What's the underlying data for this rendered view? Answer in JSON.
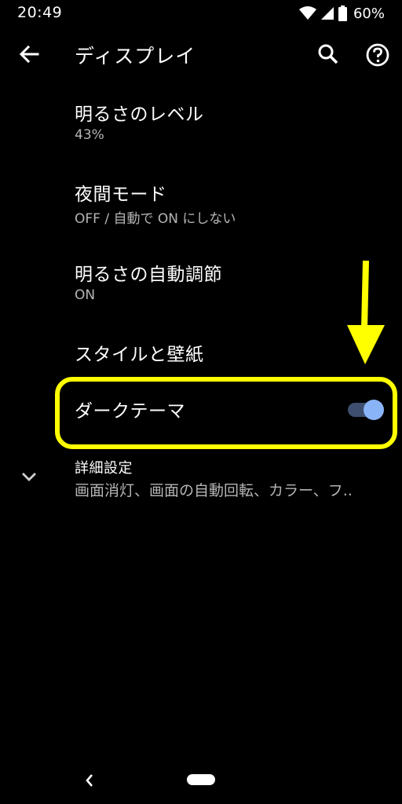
{
  "status_bar": {
    "time": "20:49",
    "battery_percent": "60%",
    "icons": [
      "wifi-icon",
      "cellular-signal-icon",
      "battery-icon"
    ]
  },
  "app_bar": {
    "title": "ディスプレイ",
    "icons": [
      "back-arrow-icon",
      "search-icon",
      "help-icon"
    ]
  },
  "settings": {
    "brightness_level": {
      "title": "明るさのレベル",
      "summary": "43%"
    },
    "night_mode": {
      "title": "夜間モード",
      "summary": "OFF / 自動で ON にしない"
    },
    "adaptive_brightness": {
      "title": "明るさの自動調節",
      "summary": "ON"
    },
    "style_wallpaper": {
      "title": "スタイルと壁紙"
    },
    "dark_theme": {
      "title": "ダークテーマ",
      "enabled": true
    },
    "advanced": {
      "title": "詳細設定",
      "summary": "画面消灯、画面の自動回転、カラー、フ..",
      "icon": "chevron-down-icon"
    }
  },
  "annotation": {
    "highlight_color": "#ffff00",
    "arrow_color": "#ffff00"
  },
  "colors": {
    "toggle_thumb": "#8ab4f8",
    "toggle_track": "#3d4e6e",
    "background": "#000000"
  }
}
